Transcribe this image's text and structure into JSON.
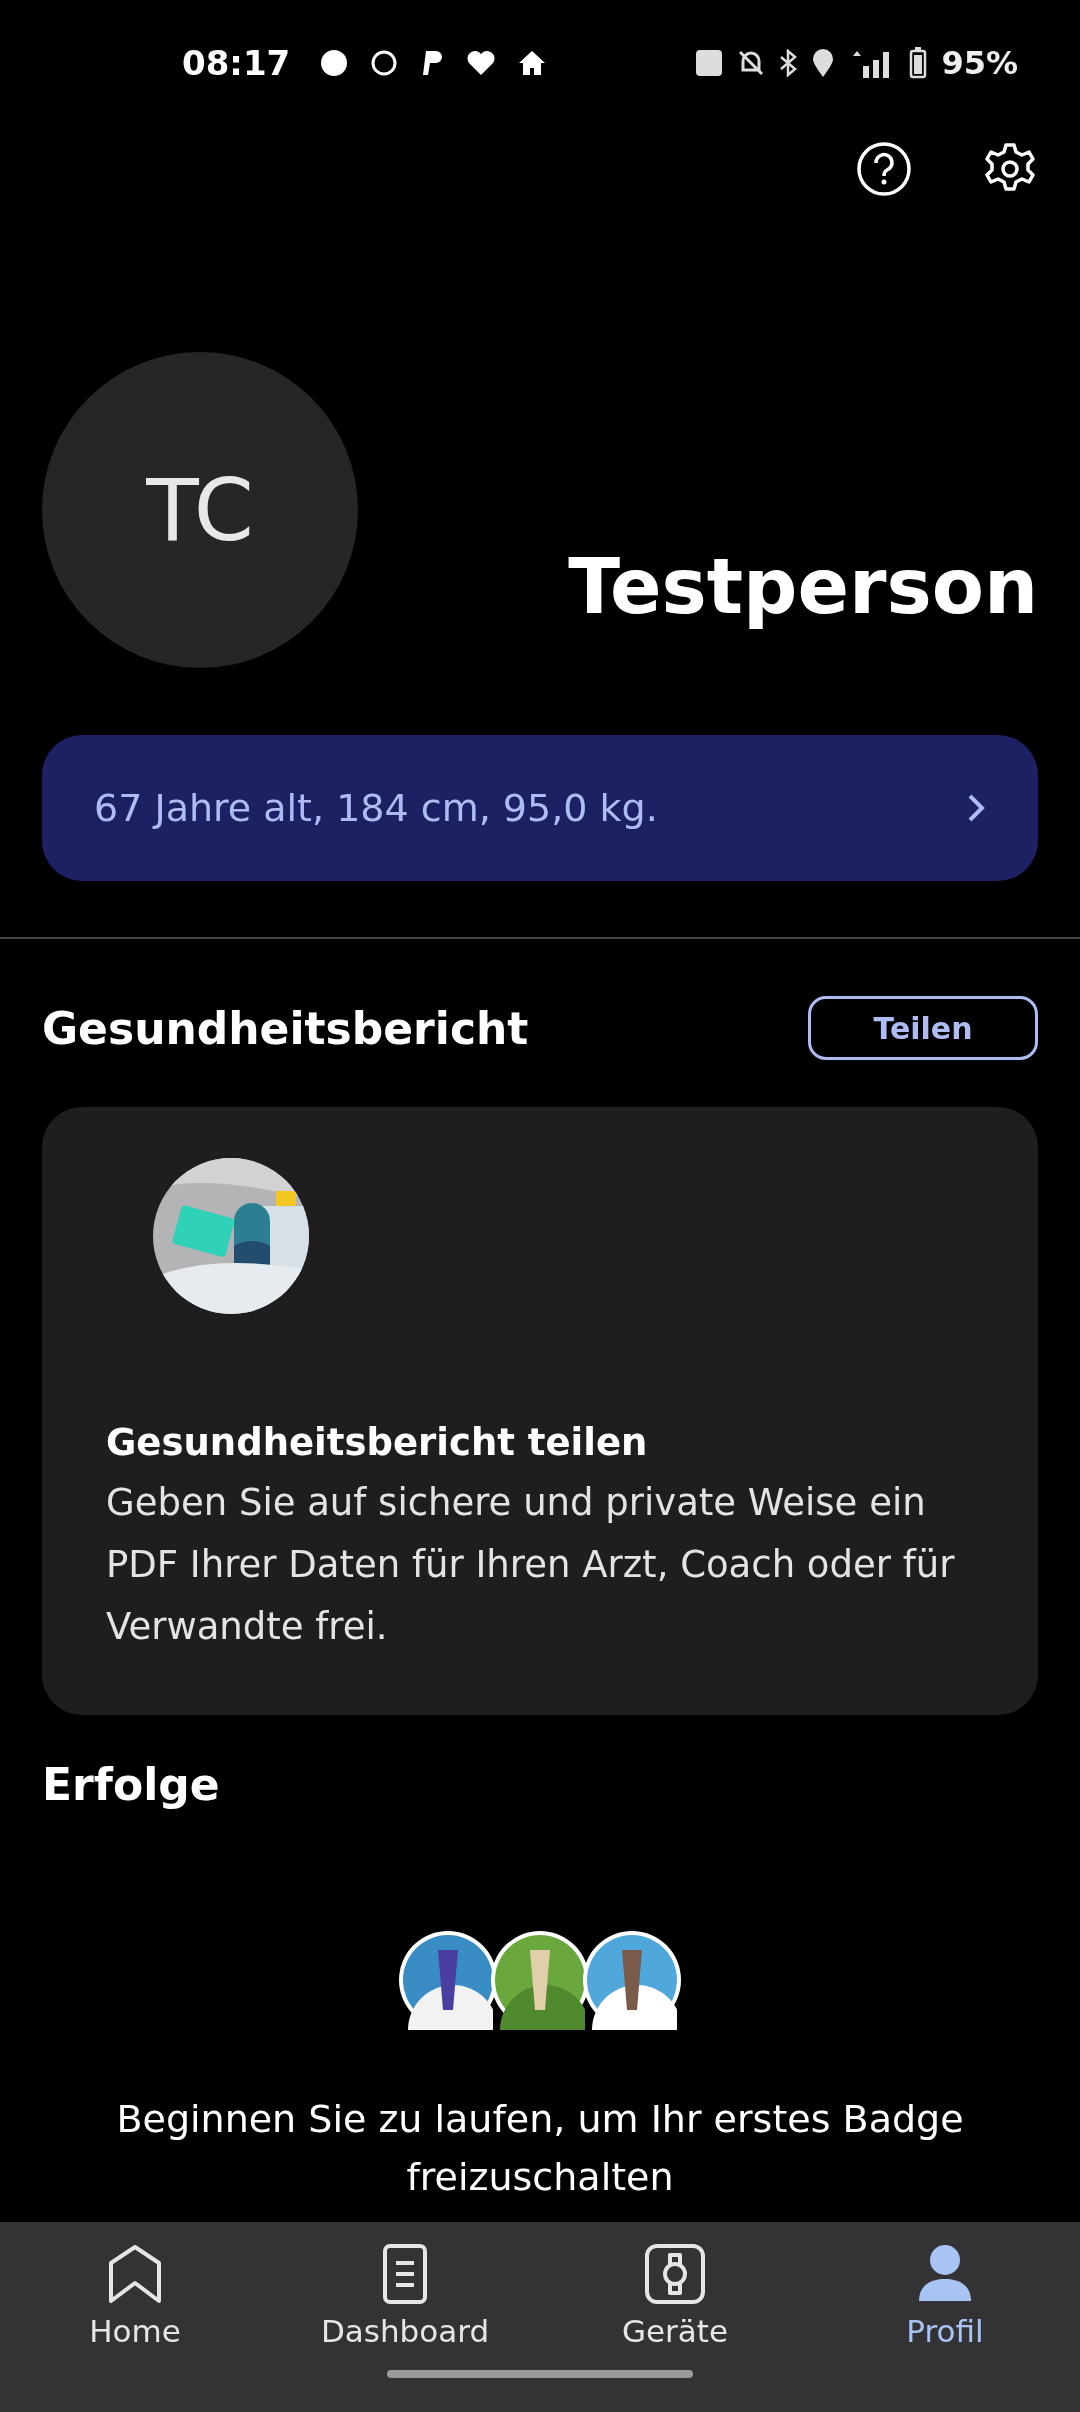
{
  "status_bar": {
    "time": "08:17",
    "battery": "95%"
  },
  "profile": {
    "initials": "TC",
    "name": "Testperson",
    "details": "67 Jahre alt, 184 cm, 95,0 kg."
  },
  "health_report": {
    "heading": "Gesundheitsbericht",
    "share_button": "Teilen",
    "card": {
      "title": "Gesundheitsbericht teilen",
      "text": "Geben Sie auf sichere und private Weise ein PDF Ihrer Daten für Ihren Arzt, Coach oder für Verwandte frei."
    }
  },
  "achievements": {
    "heading": "Erfolge",
    "message": "Beginnen Sie zu laufen, um Ihr erstes Badge freizuschalten"
  },
  "bottom_nav": [
    {
      "label": "Home",
      "kind": "home",
      "selected": false
    },
    {
      "label": "Dashboard",
      "kind": "dashboard",
      "selected": false
    },
    {
      "label": "Geräte",
      "kind": "devices",
      "selected": false
    },
    {
      "label": "Profil",
      "kind": "profile",
      "selected": true
    }
  ]
}
